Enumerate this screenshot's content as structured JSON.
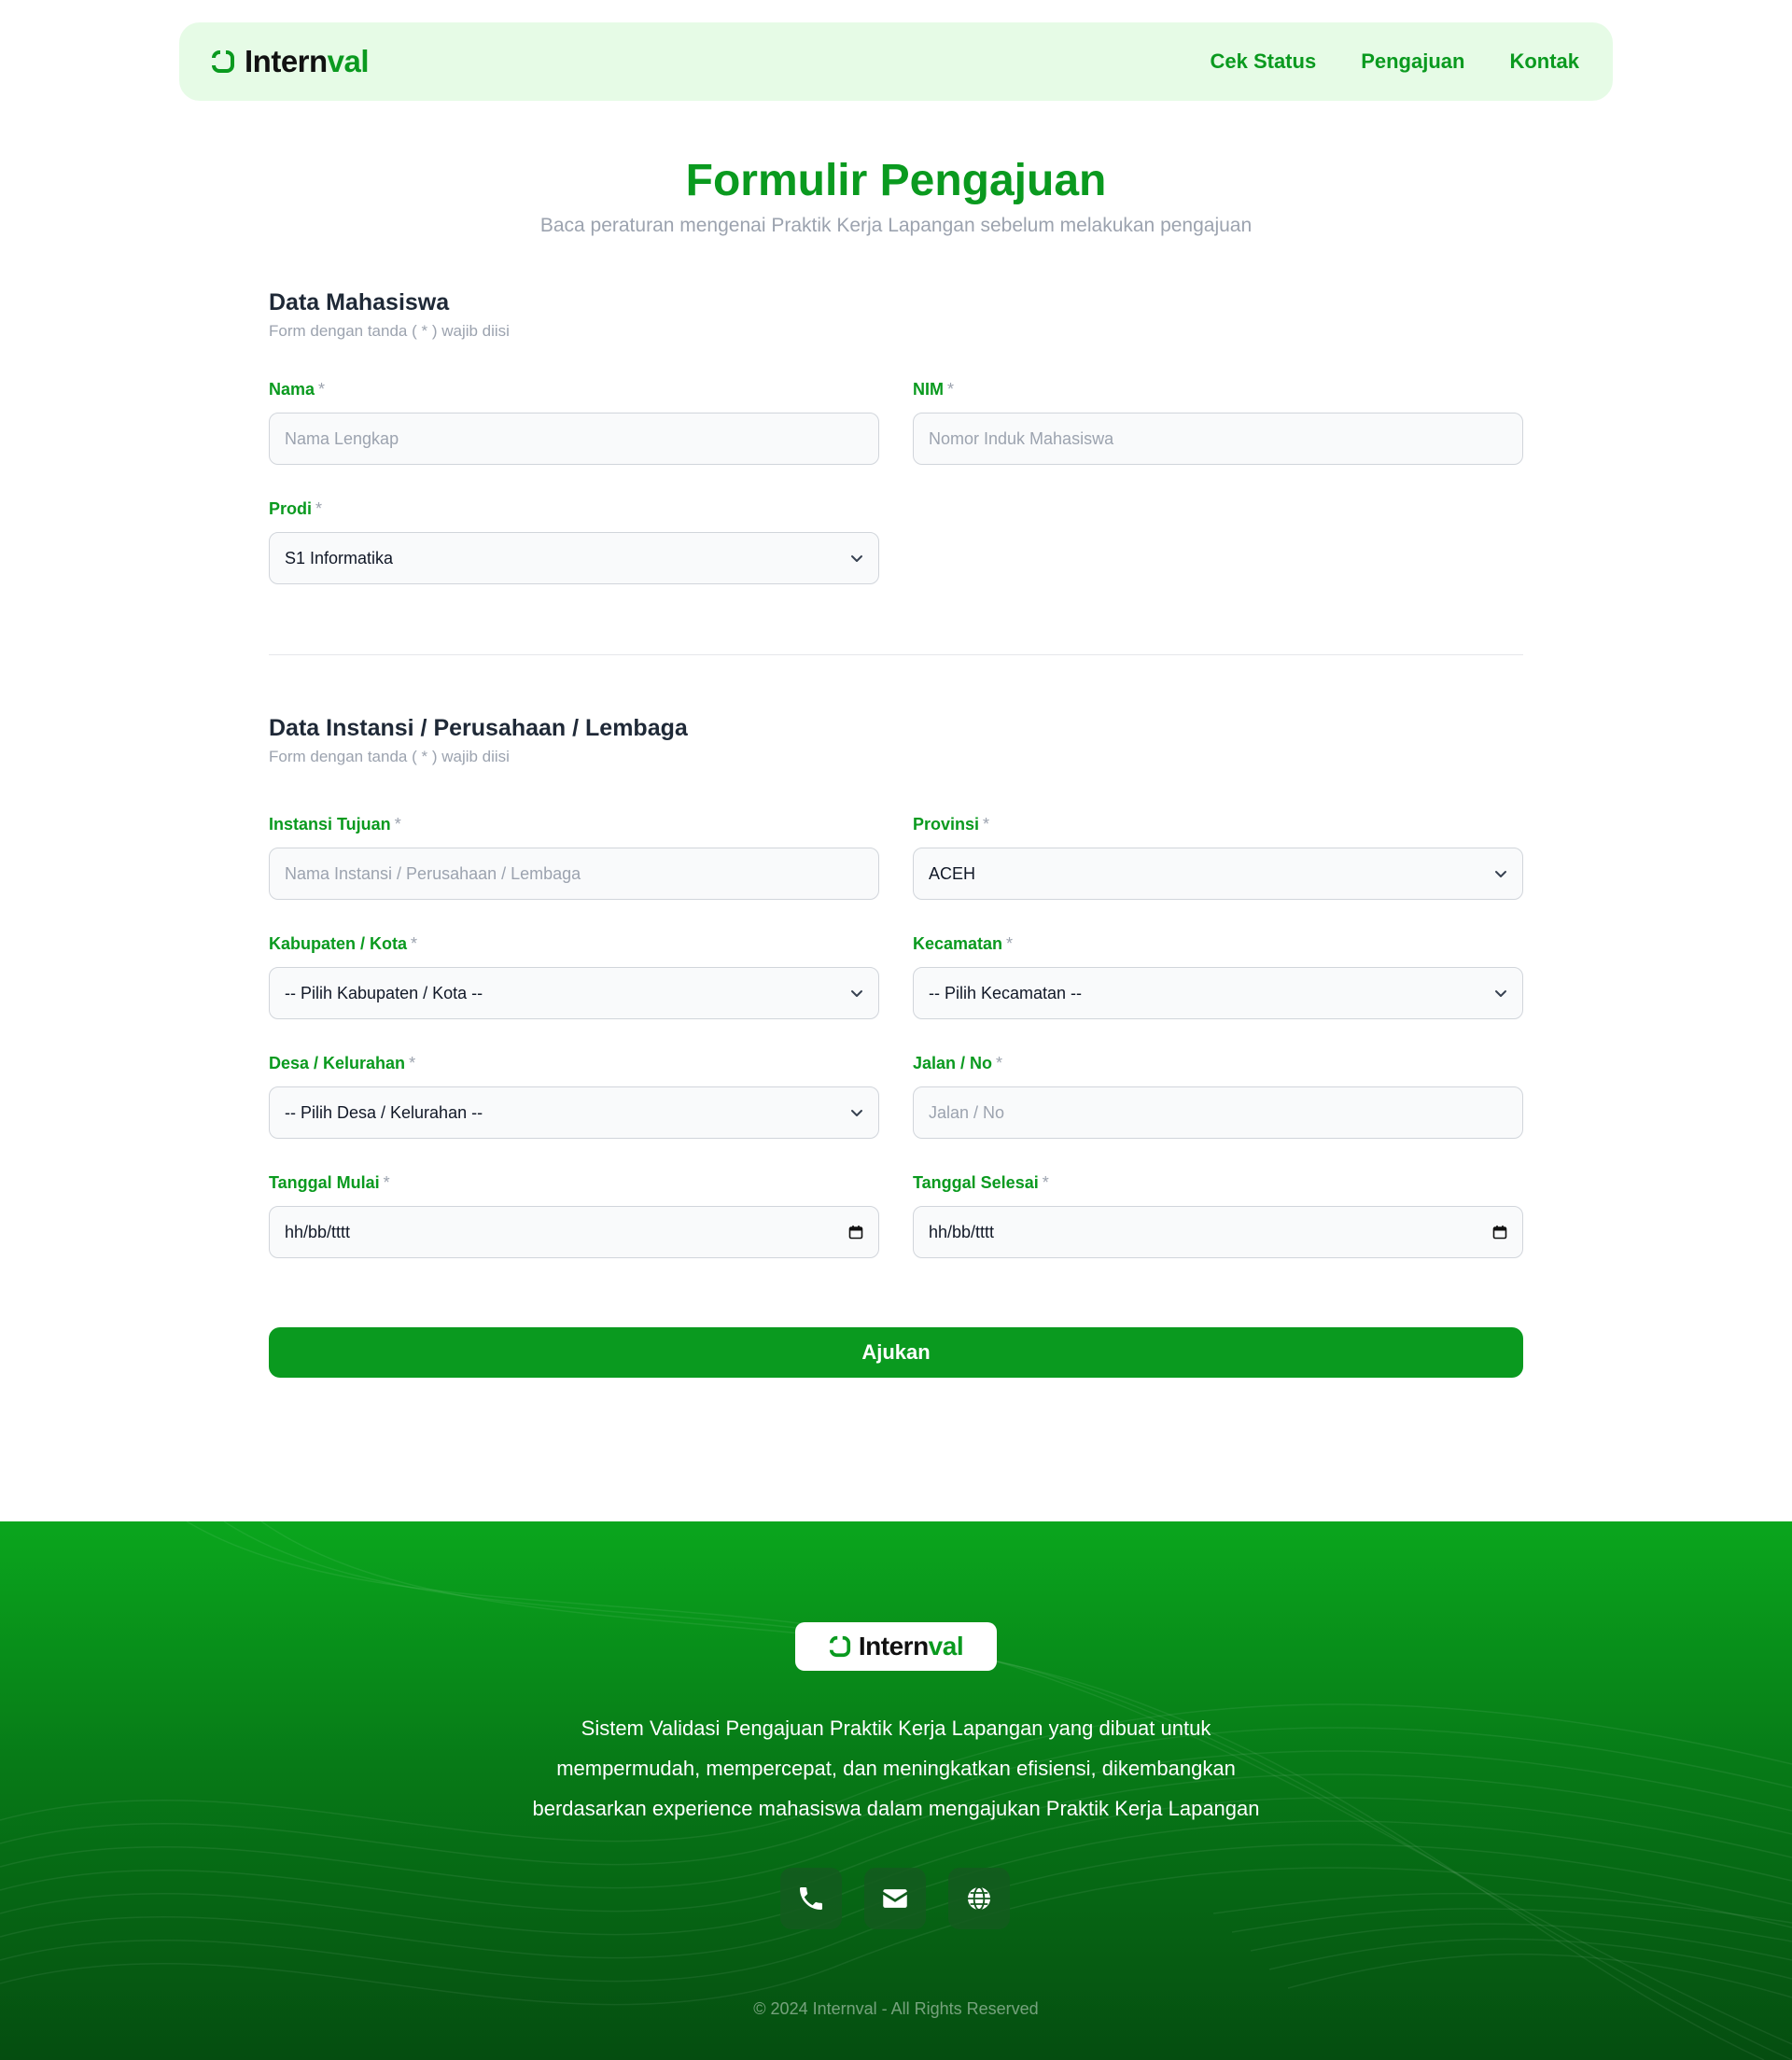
{
  "brand": {
    "name_part1": "Intern",
    "name_part2": "val",
    "primary_color": "#0a9a1f",
    "navbar_bg": "#e6fbe6"
  },
  "nav": {
    "items": [
      {
        "label": "Cek Status"
      },
      {
        "label": "Pengajuan"
      },
      {
        "label": "Kontak"
      }
    ]
  },
  "header": {
    "title": "Formulir Pengajuan",
    "subtitle": "Baca peraturan mengenai Praktik Kerja Lapangan sebelum melakukan pengajuan"
  },
  "section_mahasiswa": {
    "title": "Data Mahasiswa",
    "note": "Form dengan tanda ( * ) wajib diisi",
    "nama": {
      "label": "Nama",
      "placeholder": "Nama Lengkap"
    },
    "nim": {
      "label": "NIM",
      "placeholder": "Nomor Induk Mahasiswa"
    },
    "prodi": {
      "label": "Prodi",
      "value": "S1 Informatika"
    }
  },
  "section_instansi": {
    "title": "Data Instansi / Perusahaan / Lembaga",
    "note": "Form dengan tanda ( * ) wajib diisi",
    "instansi": {
      "label": "Instansi Tujuan",
      "placeholder": "Nama Instansi / Perusahaan / Lembaga"
    },
    "provinsi": {
      "label": "Provinsi",
      "value": "ACEH"
    },
    "kabupaten": {
      "label": "Kabupaten / Kota",
      "value": "-- Pilih Kabupaten / Kota --"
    },
    "kecamatan": {
      "label": "Kecamatan",
      "value": "-- Pilih Kecamatan --"
    },
    "desa": {
      "label": "Desa / Kelurahan",
      "value": "-- Pilih Desa / Kelurahan --"
    },
    "jalan": {
      "label": "Jalan / No",
      "placeholder": "Jalan / No"
    },
    "tanggal_mulai": {
      "label": "Tanggal Mulai",
      "value": "hh/bb/tttt"
    },
    "tanggal_selesai": {
      "label": "Tanggal Selesai",
      "value": "hh/bb/tttt"
    }
  },
  "required_marker": "*",
  "submit": {
    "label": "Ajukan"
  },
  "footer": {
    "description": "Sistem Validasi Pengajuan Praktik Kerja Lapangan yang dibuat untuk mempermudah, mempercepat, dan meningkatkan efisiensi, dikembangkan berdasarkan experience mahasiswa dalam mengajukan Praktik Kerja Lapangan",
    "socials": [
      {
        "icon": "phone-icon"
      },
      {
        "icon": "mail-icon"
      },
      {
        "icon": "globe-icon"
      }
    ],
    "copyright": "© 2024 Internval - All Rights Reserved"
  }
}
